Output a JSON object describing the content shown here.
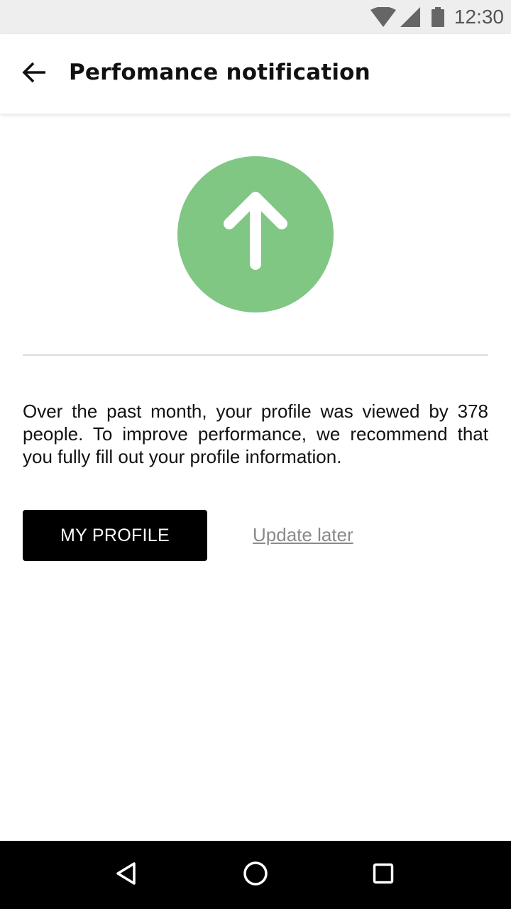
{
  "status_bar": {
    "time": "12:30",
    "icons": [
      "wifi-icon",
      "signal-icon",
      "battery-icon"
    ]
  },
  "app_bar": {
    "back_icon": "arrow-back-icon",
    "title": "Perfomance notification"
  },
  "hero": {
    "icon": "arrow-up-icon",
    "circle_color": "#81c784"
  },
  "message": {
    "text": "Over the past month, your profile was viewed by 378 people. To improve performance, we recommend that you fully fill out your profile information."
  },
  "actions": {
    "primary_label": "MY PROFILE",
    "secondary_label": "Update later"
  },
  "nav_bar": {
    "items": [
      "back-triangle-icon",
      "home-circle-icon",
      "recents-square-icon"
    ]
  }
}
